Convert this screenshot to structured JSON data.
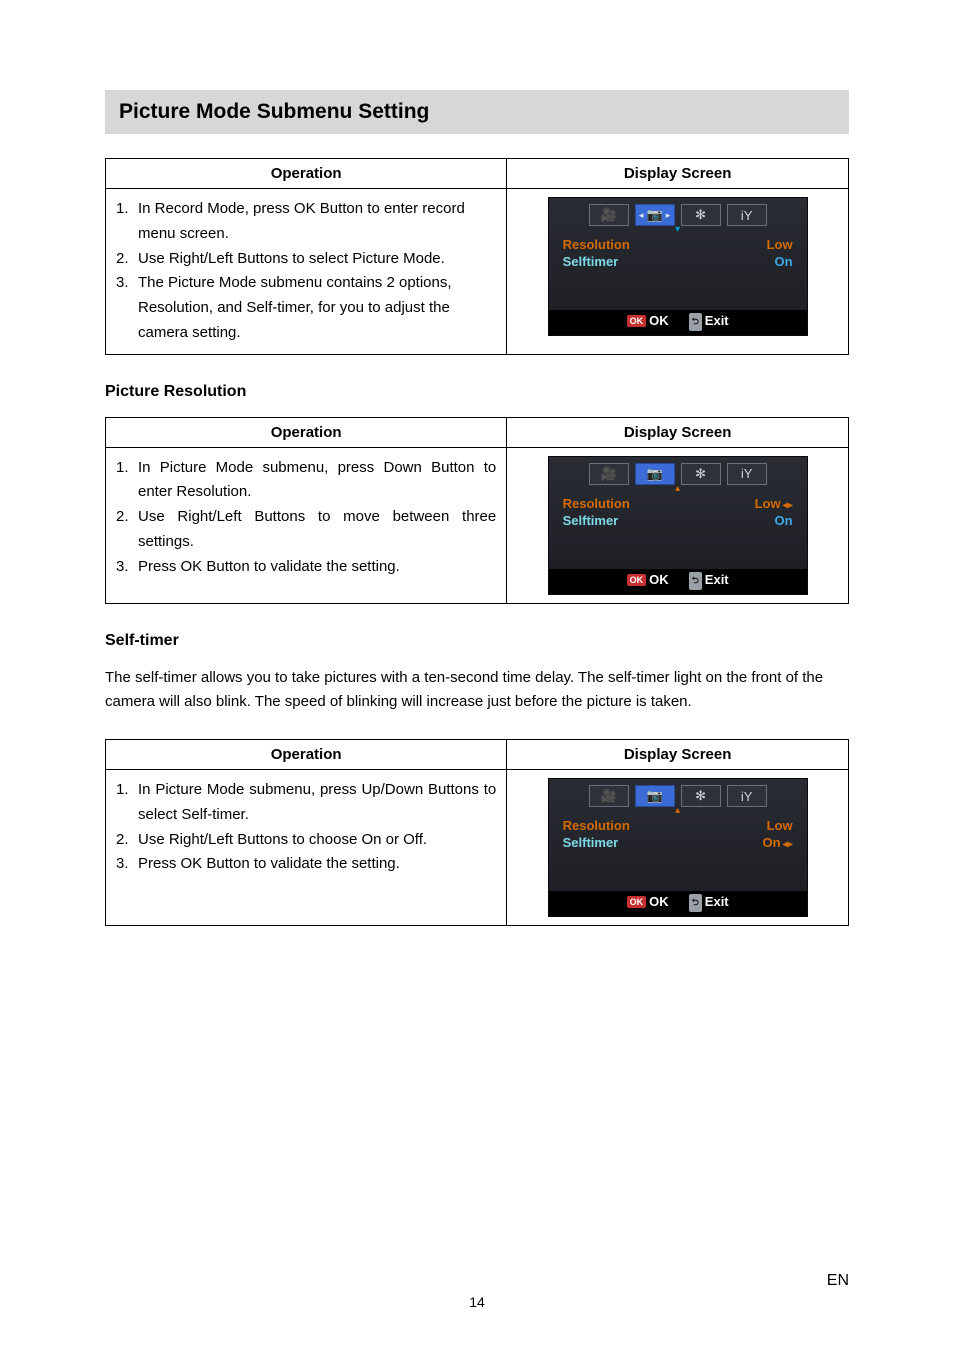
{
  "section_title": "Picture Mode Submenu Setting",
  "table1": {
    "head_op": "Operation",
    "head_screen": "Display Screen",
    "steps": [
      "In Record Mode, press OK Button to enter record menu screen.",
      "Use Right/Left Buttons to select Picture Mode.",
      "The Picture Mode submenu contains 2 options, Resolution, and Self-timer, for you to adjust the camera setting."
    ]
  },
  "sub1_title": "Picture Resolution",
  "table2": {
    "head_op": "Operation",
    "head_screen": "Display Screen",
    "steps": [
      "In Picture Mode submenu, press Down Button to enter Resolution.",
      "Use Right/Left Buttons to move between three settings.",
      "Press OK Button to validate the setting."
    ]
  },
  "sub2_title": "Self-timer",
  "self_timer_para": "The self-timer allows you to take pictures with a ten-second time delay. The self-timer light on the front of the camera will also blink. The speed of blinking will increase just before the picture is taken.",
  "table3": {
    "head_op": "Operation",
    "head_screen": "Display Screen",
    "steps": [
      "In Picture Mode submenu, press Up/Down Buttons to select Self-timer.",
      "Use Right/Left Buttons to choose On or Off.",
      "Press OK Button to validate the setting."
    ]
  },
  "lcd": {
    "row_resolution": "Resolution",
    "row_selftimer": "Selftimer",
    "val_low": "Low",
    "val_on": "On",
    "ok_badge": "OK",
    "ok_label": "OK",
    "exit_label": "Exit",
    "tab_labels": {
      "video": "🎥",
      "camera": "📷",
      "effect": "✻",
      "setting": "iY"
    }
  },
  "page_number": "14",
  "lang_badge": "EN"
}
